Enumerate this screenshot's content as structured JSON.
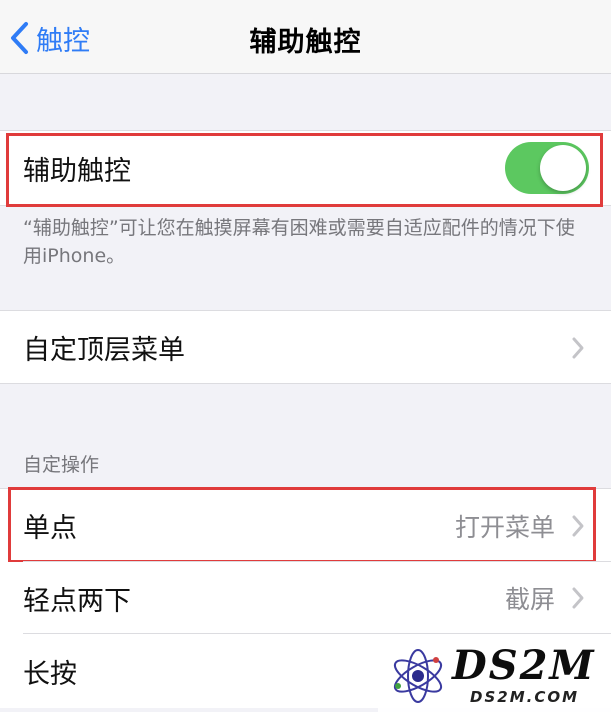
{
  "nav": {
    "back_label": "触控",
    "title": "辅助触控"
  },
  "assistive_touch": {
    "label": "辅助触控",
    "toggle_on": true,
    "footer": "“辅助触控”可让您在触摸屏幕有困难或需要自适应配件的情况下使用iPhone。"
  },
  "top_level_menu": {
    "label": "自定顶层菜单"
  },
  "custom_actions": {
    "header": "自定操作",
    "items": [
      {
        "label": "单点",
        "value": "打开菜单"
      },
      {
        "label": "轻点两下",
        "value": "截屏"
      },
      {
        "label": "长按",
        "value": ""
      }
    ]
  },
  "colors": {
    "accent": "#2f7cf6",
    "toggle_on": "#5cc860",
    "highlight": "#e03b3b"
  },
  "watermark": {
    "brand": "DS2M",
    "url": "DS2M.COM"
  }
}
